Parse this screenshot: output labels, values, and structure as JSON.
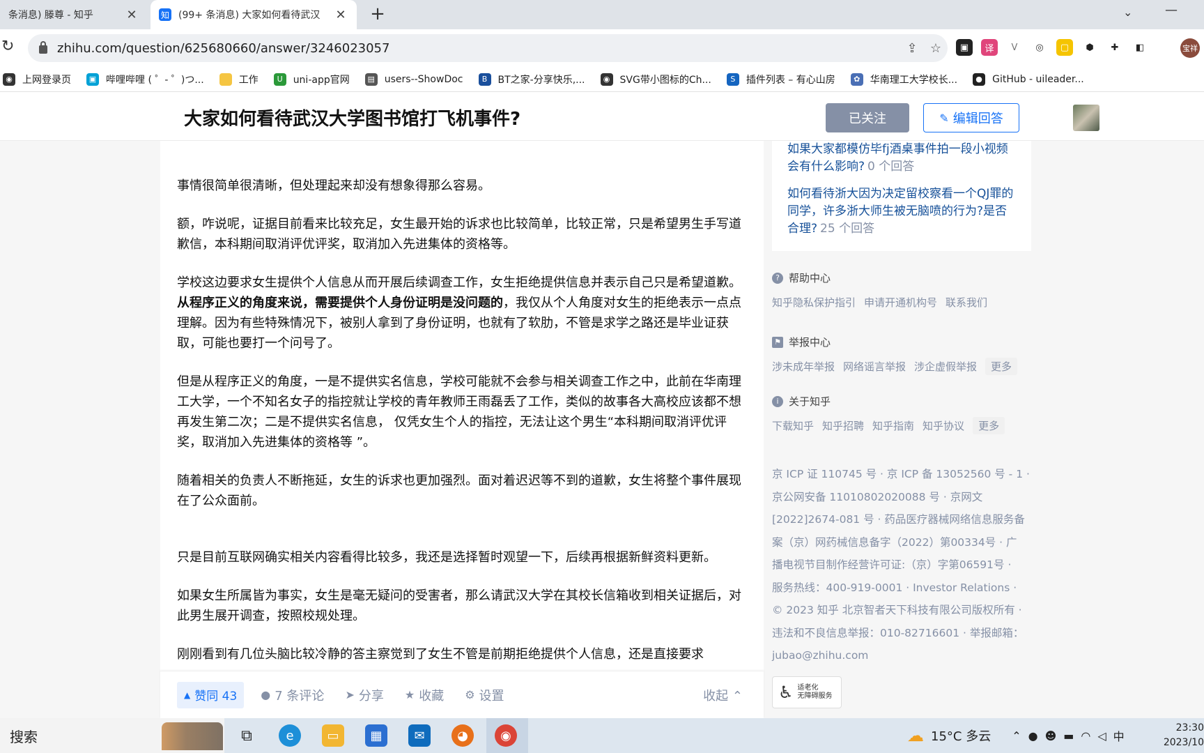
{
  "browser": {
    "tabs": [
      {
        "title": "条消息) 滕尊 - 知乎",
        "active": false
      },
      {
        "title": "(99+ 条消息) 大家如何看待武汉",
        "active": true,
        "favicon": "知"
      }
    ],
    "new_tab": "+",
    "url": "zhihu.com/question/625680660/answer/3246023057",
    "profile_label": "宝祥",
    "bookmarks": [
      {
        "label": "上网登录页",
        "icon_color": "#333333"
      },
      {
        "label": "哔哩哔哩 ( ゜- ゜)つ...",
        "icon_color": "#00a1d6"
      },
      {
        "label": "工作",
        "icon_color": "#f5c542"
      },
      {
        "label": "uni-app官网",
        "icon_color": "#2b9939"
      },
      {
        "label": "users--ShowDoc",
        "icon_color": "#555555"
      },
      {
        "label": "BT之家-分享快乐,...",
        "icon_color": "#1a4f9c"
      },
      {
        "label": "SVG带小图标的Ch...",
        "icon_color": "#333333"
      },
      {
        "label": "插件列表 – 有心山房",
        "icon_color": "#1565c0"
      },
      {
        "label": "华南理工大学校长...",
        "icon_color": "#4a6fb5"
      },
      {
        "label": "GitHub - uileader...",
        "icon_color": "#222222"
      }
    ]
  },
  "zhihu": {
    "question_title": "大家如何看待武汉大学图书馆打飞机事件?",
    "followed_label": "已关注",
    "edit_answer_label": "编辑回答",
    "answer_paragraphs": {
      "p1": "事情很简单很清晰，但处理起来却没有想象得那么容易。",
      "p2": "额，咋说呢，证据目前看来比较充足，女生最开始的诉求也比较简单，比较正常，只是希望男生手写道歉信，本科期间取消评优评奖，取消加入先进集体的资格等。",
      "p3_start": "学校这边要求女生提供个人信息从而开展后续调查工作，女生拒绝提供信息并表示自己只是希望道歉。",
      "p3_bold": "从程序正义的角度来说，需要提供个人身份证明是没问题的",
      "p3_end": "，我仅从个人角度对女生的拒绝表示一点点理解。因为有些特殊情况下，被别人拿到了身份证明，也就有了软肋，不管是求学之路还是毕业证获取，可能也要打一个问号了。",
      "p4": "但是从程序正义的角度，一是不提供实名信息，学校可能就不会参与相关调查工作之中，此前在华南理工大学，一个不知名女子的指控就让学校的青年教师王雨磊丢了工作，类似的故事各大高校应该都不想再发生第二次；二是不提供实名信息， 仅凭女生个人的指控，无法让这个男生“本科期间取消评优评奖，取消加入先进集体的资格等 ”。",
      "p5": "随着相关的负责人不断拖延，女生的诉求也更加强烈。面对着迟迟等不到的道歉，女生将整个事件展现在了公众面前。",
      "p6": "只是目前互联网确实相关内容看得比较多，我还是选择暂时观望一下，后续再根据新鲜资料更新。",
      "p7": "如果女生所属皆为事实，女生是毫无疑问的受害者，那么请武汉大学在其校长信箱收到相关证据后，对此男生展开调查，按照校规处理。",
      "p8": "刚刚看到有几位头脑比较冷静的答主察觉到了女生不管是前期拒绝提供个人信息，还是直接要求"
    },
    "actions": {
      "vote": "赞同 43",
      "comments": "7 条评论",
      "share": "分享",
      "favorite": "收藏",
      "settings": "设置",
      "collapse": "收起"
    },
    "related": [
      {
        "question": "如果大家都模仿毕fj酒桌事件拍一段小视频会有什么影响?",
        "count": "0 个回答"
      },
      {
        "question": "如何看待浙大因为决定留校察看一个QJ罪的同学，许多浙大师生被无脑喷的行为?是否合理?",
        "count": "25 个回答"
      }
    ],
    "help_center": {
      "title": "帮助中心",
      "links": [
        "知乎隐私保护指引",
        "申请开通机构号",
        "联系我们"
      ]
    },
    "report_center": {
      "title": "举报中心",
      "links": [
        "涉未成年举报",
        "网络谣言举报",
        "涉企虚假举报"
      ],
      "more": "更多"
    },
    "about": {
      "title": "关于知乎",
      "links": [
        "下载知乎",
        "知乎招聘",
        "知乎指南",
        "知乎协议"
      ],
      "more": "更多"
    },
    "footer_lines": [
      "京 ICP 证 110745 号 · 京 ICP 备 13052560 号 - 1 ·",
      "京公网安备 11010802020088 号 · 京网文",
      "[2022]2674-081 号 · 药品医疗器械网络信息服务备",
      "案（京）网药械信息备字（2022）第00334号 · 广",
      "播电视节目制作经营许可证:（京）字第06591号 ·",
      "服务热线：400-919-0001 · Investor Relations ·",
      "© 2023 知乎 北京智者天下科技有限公司版权所有 ·",
      "违法和不良信息举报：010-82716601 · 举报邮箱：",
      "jubao@zhihu.com"
    ],
    "elder_service": [
      "适老化",
      "无障碍服务"
    ]
  },
  "taskbar": {
    "search_label": "搜索",
    "weather": "15°C 多云",
    "ime": "中",
    "time": "23:30",
    "date": "2023/10"
  },
  "colors": {
    "zhihu_blue": "#1772f6",
    "link_blue": "#175199",
    "muted": "#8590a6"
  }
}
